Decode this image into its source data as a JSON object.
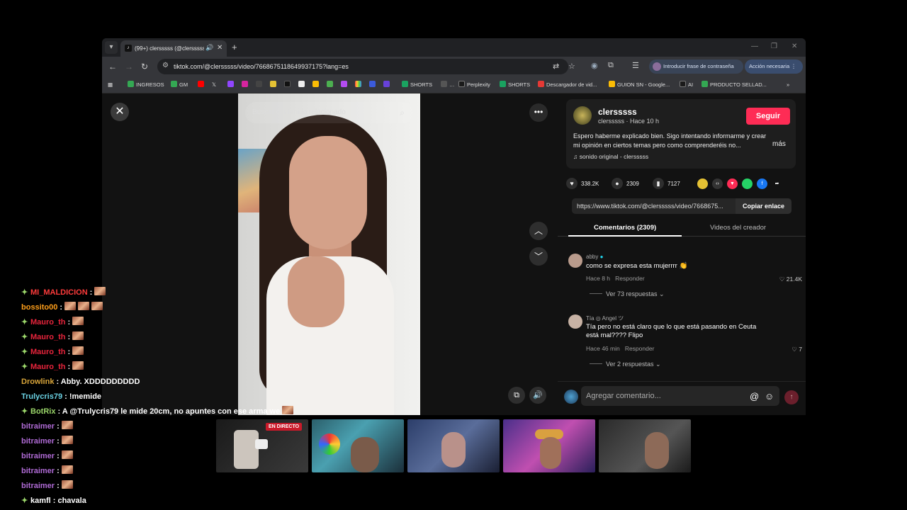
{
  "browser": {
    "tab_title": "(99+) clersssss (@clersssss)",
    "url": "tiktok.com/@clersssss/video/7668675118649937175?lang=es",
    "password_btn": "Introducir frase de contraseña",
    "action_btn": "Acción necesaria",
    "bookmarks": [
      "INGRESOS",
      "GM",
      "SHORTS",
      "Perplexity",
      "SHORTS",
      "Descargador de vid...",
      "GUION SN - Google...",
      "AI",
      "PRODUCTO SELLAD..."
    ],
    "accent": "#8ab4f8"
  },
  "video": {
    "search_placeholder": "Buscar contenido relacionado"
  },
  "post": {
    "username": "clersssss",
    "subline": "clersssss · Hace 10 h",
    "follow_label": "Seguir",
    "description": "Espero haberme explicado bien. Sigo intentando informarme y crear mi opinión en ciertos temas pero como comprenderéis no...",
    "more_label": "más",
    "sound": "sonido original - clersssss",
    "likes": "338.2K",
    "comments": "2309",
    "saves": "7127",
    "link": "https://www.tiktok.com/@clersssss/video/7668675...",
    "copy_label": "Copiar enlace",
    "brand_color": "#fe2c55"
  },
  "tabs": {
    "comments": "Comentarios (2309)",
    "creator_videos": "Videos del creador"
  },
  "comments": [
    {
      "user": "abby",
      "text": "como se expresa esta mujerrrr 👏",
      "time": "Hace 8 h",
      "reply": "Responder",
      "likes": "21.4K",
      "replies": "Ver 73 respuestas"
    },
    {
      "user": "Tía ◎ Angel ツ",
      "text": "Tía pero no está claro que lo que está pasando en Ceuta está mal???? Flipo",
      "time": "Hace 46 min",
      "reply": "Responder",
      "likes": "7",
      "replies": "Ver 2 respuestas"
    }
  ],
  "composer": {
    "placeholder": "Agregar comentario..."
  },
  "chat": [
    {
      "user": "MI_MALDICION",
      "color": "#ff3b3b",
      "msg": ":",
      "emotes": 1,
      "badge": true
    },
    {
      "user": "bossito00",
      "color": "#ff9f1a",
      "msg": ":",
      "emotes": 3,
      "badge": false
    },
    {
      "user": "Mauro_th",
      "color": "#e8243c",
      "msg": ":",
      "emotes": 1,
      "badge": true
    },
    {
      "user": "Mauro_th",
      "color": "#e8243c",
      "msg": ":",
      "emotes": 1,
      "badge": true
    },
    {
      "user": "Mauro_th",
      "color": "#e8243c",
      "msg": ":",
      "emotes": 1,
      "badge": true
    },
    {
      "user": "Mauro_th",
      "color": "#e8243c",
      "msg": ":",
      "emotes": 1,
      "badge": true
    },
    {
      "user": "Drowlink",
      "color": "#d9a53a",
      "msg": ": Abby. XDDDDDDDDD",
      "emotes": 0,
      "badge": false
    },
    {
      "user": "Trulycris79",
      "color": "#6ad1e3",
      "msg": ": !memide",
      "emotes": 0,
      "badge": false
    },
    {
      "user": "BotRix",
      "color": "#9bd66a",
      "msg": ": A @Trulycris79 le mide 20cm, no apuntes con ese arma we",
      "emotes": 1,
      "badge": true
    },
    {
      "user": "bitraimer",
      "color": "#b06bd6",
      "msg": ":",
      "emotes": 1,
      "badge": false
    },
    {
      "user": "bitraimer",
      "color": "#b06bd6",
      "msg": ":",
      "emotes": 1,
      "badge": false
    },
    {
      "user": "bitraimer",
      "color": "#b06bd6",
      "msg": ":",
      "emotes": 1,
      "badge": false
    },
    {
      "user": "bitraimer",
      "color": "#b06bd6",
      "msg": ":",
      "emotes": 1,
      "badge": false
    },
    {
      "user": "bitraimer",
      "color": "#b06bd6",
      "msg": ":",
      "emotes": 1,
      "badge": false
    },
    {
      "user": "kamfl",
      "color": "#ffffff",
      "msg": ": chavala",
      "emotes": 0,
      "badge": true
    }
  ],
  "live_label": "EN DIRECTO"
}
